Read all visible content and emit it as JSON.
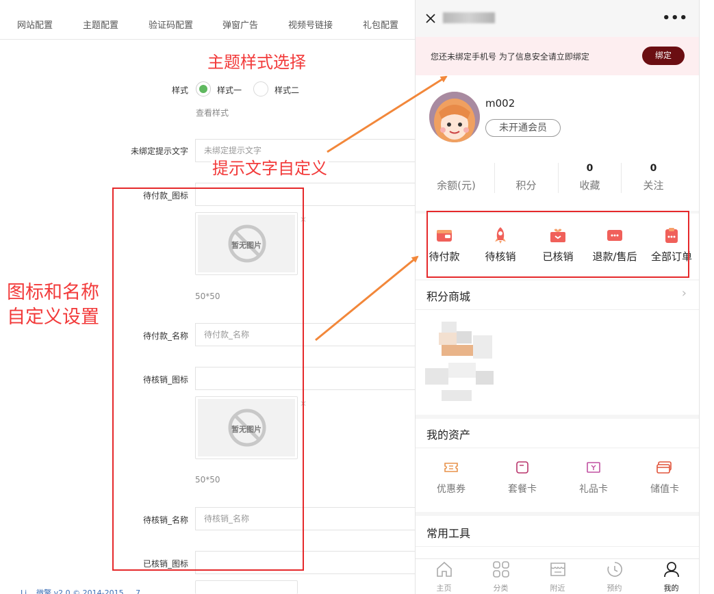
{
  "tabs": [
    "网站配置",
    "主题配置",
    "验证码配置",
    "弹窗广告",
    "视频号链接",
    "礼包配置"
  ],
  "annotations": {
    "theme_style": "主题样式选择",
    "prompt_text": "提示文字自定义",
    "icon_name_line1": "图标和名称",
    "icon_name_line2": "自定义设置"
  },
  "form": {
    "style_label": "样式",
    "style_option_1": "样式一",
    "style_option_2": "样式二",
    "view_style": "查看样式",
    "unbound_label": "未绑定提示文字",
    "unbound_placeholder": "未绑定提示文字",
    "pay_icon_label": "待付款_图标",
    "no_image": "暂无图片",
    "size_hint_1": "50*50",
    "pay_name_label": "待付款_名称",
    "pay_name_placeholder": "待付款_名称",
    "verify_icon_label": "待核销_图标",
    "size_hint_2": "50*50",
    "verify_name_label": "待核销_名称",
    "verify_name_placeholder": "待核销_名称",
    "verified_icon_label": "已核销_图标"
  },
  "phone": {
    "close_icon": "close-icon",
    "bind_text": "您还未绑定手机号 为了信息安全请立即绑定",
    "bind_button": "绑定",
    "username": "m002",
    "vip_badge": "未开通会员",
    "stats": [
      {
        "num": "",
        "label": "余额(元)"
      },
      {
        "num": "",
        "label": "积分"
      },
      {
        "num": "0",
        "label": "收藏"
      },
      {
        "num": "0",
        "label": "关注"
      }
    ],
    "orders": [
      "待付款",
      "待核销",
      "已核销",
      "退款/售后",
      "全部订单"
    ],
    "points_mall": "积分商城",
    "my_assets": "我的资产",
    "assets": [
      "优惠券",
      "套餐卡",
      "礼品卡",
      "储值卡"
    ],
    "common_tools": "常用工具",
    "nav": [
      "主页",
      "分类",
      "附近",
      "预约",
      "我的"
    ]
  },
  "colors": {
    "accent_red": "#f23a3a",
    "bind_button": "#6b0e12",
    "radio_on": "#5fb85f",
    "order_icon": "#f0605a"
  },
  "footer": "Li... 微擎 v2.0 © 2014-2015 ... 7"
}
